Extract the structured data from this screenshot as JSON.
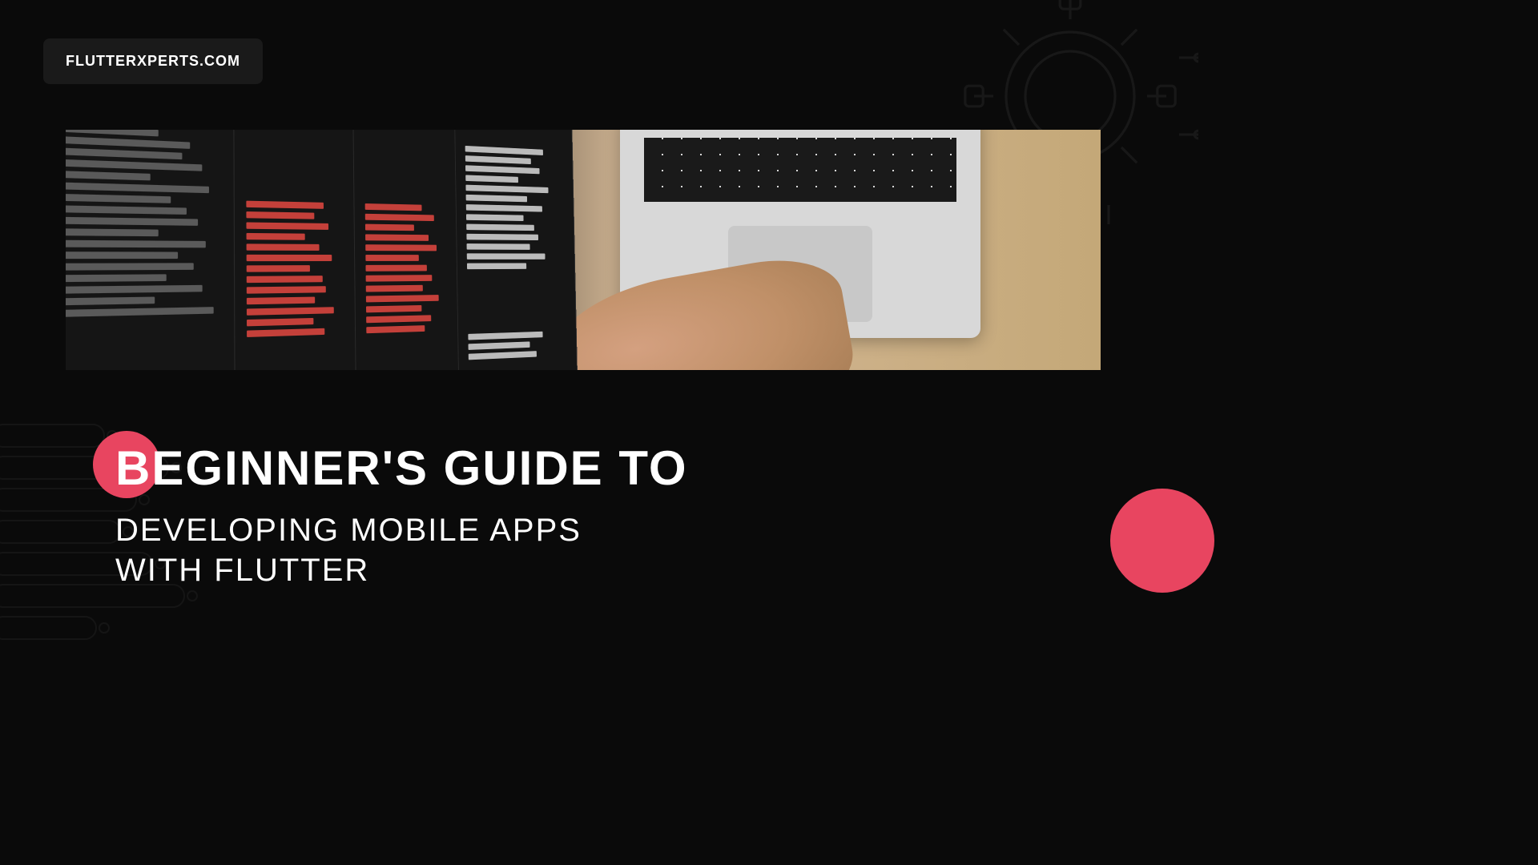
{
  "badge": {
    "text": "FLUTTERXPERTS.COM"
  },
  "title": {
    "main": "BEGINNER'S GUIDE TO",
    "sub1": "DEVELOPING MOBILE APPS",
    "sub2": "WITH FLUTTER"
  },
  "colors": {
    "accent": "#e84560",
    "background": "#0a0a0a",
    "text": "#ffffff"
  }
}
